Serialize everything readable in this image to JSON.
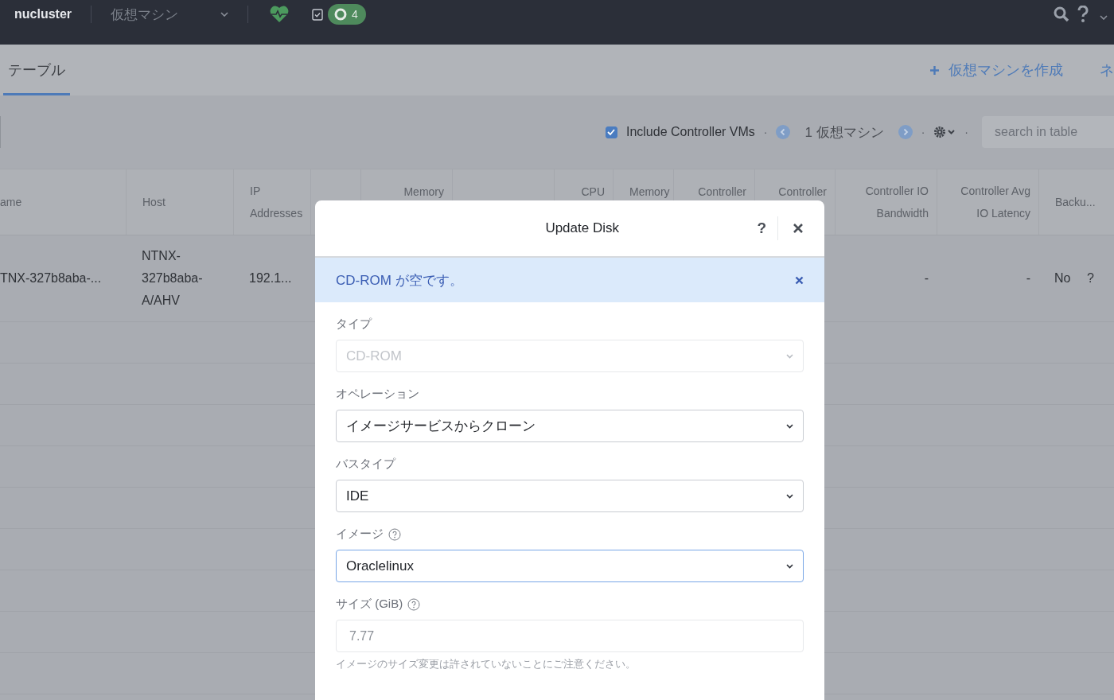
{
  "topbar": {
    "cluster": "nucluster",
    "section": "仮想マシン",
    "alert_count": "4"
  },
  "tabs": [
    {
      "label": "テーブル",
      "selected": true
    }
  ],
  "actions": [
    {
      "label": "仮想マシンを作成"
    },
    {
      "label": "ネ"
    }
  ],
  "toolbar": {
    "include_controller": {
      "label": "Include Controller VMs",
      "checked": true
    },
    "separators": [
      "·",
      "·",
      "·"
    ],
    "count": "1 仮想マシン",
    "search": {
      "placeholder": "search in table"
    }
  },
  "table": {
    "columns": [
      {
        "label": "ame"
      },
      {
        "label": "Host"
      },
      {
        "label": "IP Addresses"
      },
      {},
      {
        "label": "Memory"
      },
      {},
      {
        "label": "CPU"
      },
      {
        "label": "Memory"
      },
      {
        "label": "Controller"
      },
      {
        "label": "Controller"
      },
      {
        "label": "Controller IO Bandwidth"
      },
      {
        "label": "Controller Avg IO Latency"
      },
      {
        "label": "Backu..."
      }
    ],
    "rows": [
      {
        "cells": [
          "TNX-327b8aba-...",
          "NTNX-327b8aba-A/AHV",
          "192.1...",
          "",
          "",
          "",
          "",
          "",
          "",
          "",
          "-",
          "-",
          "No"
        ],
        "backup_help": "?"
      }
    ]
  },
  "dialog": {
    "title": "Update Disk",
    "help": "?",
    "alert": "CD-ROM が空です。",
    "fields": [
      {
        "kind": "select",
        "label": "タイプ",
        "value": "CD-ROM",
        "disabled": true,
        "focused": false,
        "help": false
      },
      {
        "kind": "select",
        "label": "オペレーション",
        "value": "イメージサービスからクローン",
        "disabled": false,
        "focused": false,
        "help": false
      },
      {
        "kind": "select",
        "label": "バスタイプ",
        "value": "IDE",
        "disabled": false,
        "focused": false,
        "help": false
      },
      {
        "kind": "select",
        "label": "イメージ",
        "value": "Oraclelinux",
        "disabled": false,
        "focused": true,
        "help": true
      },
      {
        "kind": "input",
        "label": "サイズ (GiB)",
        "value": "7.77",
        "disabled": true,
        "focused": false,
        "help": true,
        "note": "イメージのサイズ変更は許されていないことにご注意ください。"
      }
    ]
  }
}
